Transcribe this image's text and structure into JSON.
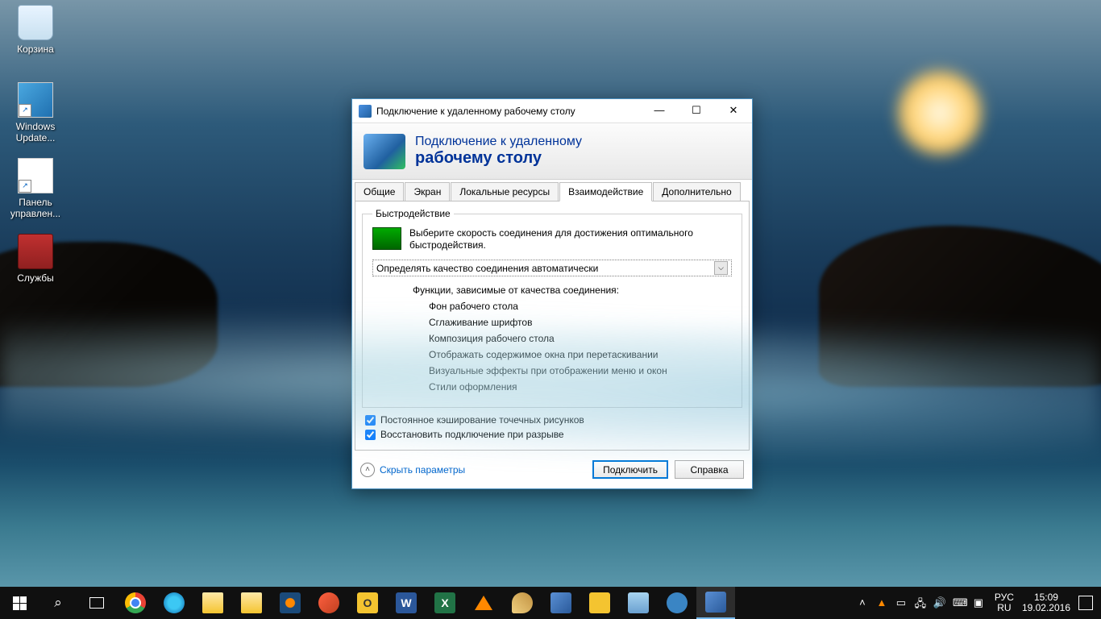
{
  "desktop": {
    "icons": {
      "recycle": "Корзина",
      "winupdate": "Windows Update...",
      "controlpanel": "Панель управлен...",
      "services": "Службы"
    }
  },
  "window": {
    "title": "Подключение к удаленному рабочему столу",
    "banner_line1": "Подключение к удаленному",
    "banner_line2": "рабочему столу",
    "tabs": {
      "general": "Общие",
      "display": "Экран",
      "localres": "Локальные ресурсы",
      "experience": "Взаимодействие",
      "advanced": "Дополнительно"
    },
    "perf": {
      "legend": "Быстродействие",
      "desc": "Выберите скорость соединения для достижения оптимального быстродействия.",
      "combo": "Определять качество соединения автоматически",
      "sublabel": "Функции, зависимые от качества соединения:",
      "features": {
        "f1": "Фон рабочего стола",
        "f2": "Сглаживание шрифтов",
        "f3": "Композиция рабочего стола",
        "f4": "Отображать содержимое окна при перетаскивании",
        "f5": "Визуальные эффекты при отображении меню и окон",
        "f6": "Стили оформления"
      }
    },
    "chk_cache": "Постоянное кэширование точечных рисунков",
    "chk_reconnect": "Восстановить подключение при разрыве",
    "hideparams": "Скрыть параметры",
    "connect": "Подключить",
    "help": "Справка"
  },
  "tray": {
    "lang1": "РУС",
    "lang2": "RU",
    "time": "15:09",
    "date": "19.02.2016"
  }
}
